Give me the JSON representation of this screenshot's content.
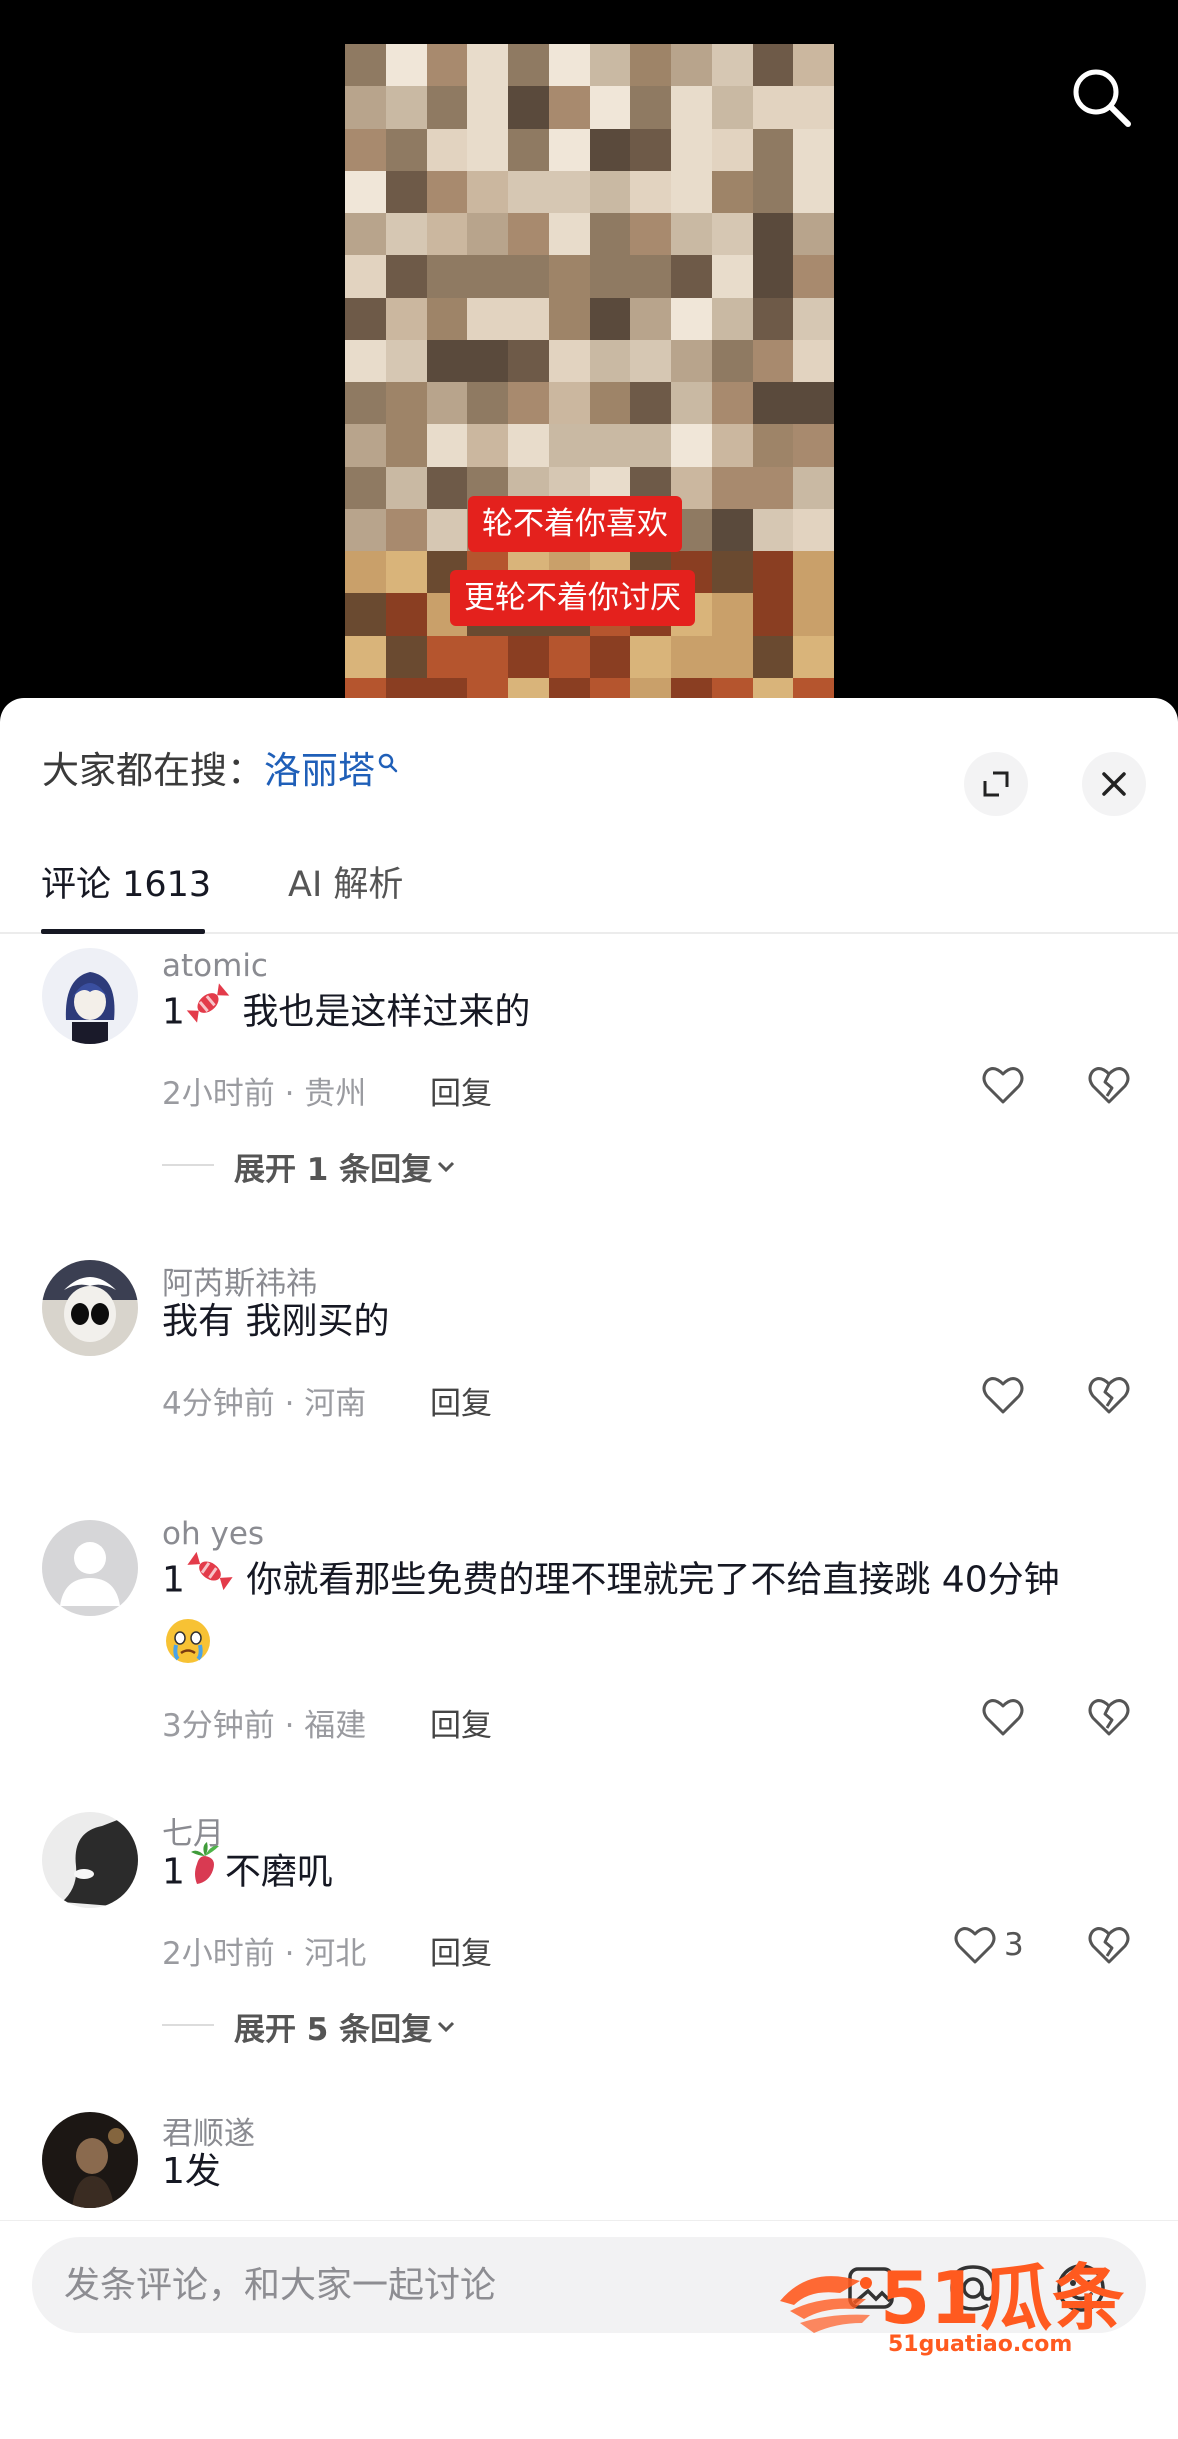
{
  "video": {
    "subtitle_line_1": "轮不着你喜欢",
    "subtitle_line_2": "更轮不着你讨厌"
  },
  "sheet": {
    "search_hint_prefix": "大家都在搜：",
    "search_hint_keyword": "洛丽塔",
    "tabs": [
      {
        "label": "评论 1613",
        "active": true
      },
      {
        "label": "AI 解析",
        "active": false
      }
    ]
  },
  "comments": [
    {
      "user": "atomic",
      "text": "我也是这样过来的",
      "prefix": "1",
      "emoji": "candy-emoji",
      "time": "2小时前",
      "location": "贵州",
      "reply_label": "回复",
      "likes": "",
      "expand_label": "展开 1 条回复"
    },
    {
      "user": "阿芮斯祎祎",
      "text": "我有 我刚买的",
      "time": "4分钟前",
      "location": "河南",
      "reply_label": "回复",
      "likes": ""
    },
    {
      "user": "oh yes",
      "prefix": "1",
      "emoji": "candy-emoji",
      "text": "你就看那些免费的理不理就完了不给直接跳 40分钟",
      "emoji_after": "crying-emoji",
      "time": "3分钟前",
      "location": "福建",
      "reply_label": "回复",
      "likes": ""
    },
    {
      "user": "七月",
      "prefix": "1",
      "emoji": "radish-emoji",
      "text": "不磨叽",
      "time": "2小时前",
      "location": "河北",
      "reply_label": "回复",
      "likes": "3",
      "expand_label": "展开 5 条回复"
    },
    {
      "user": "君顺遂",
      "text": "1发"
    }
  ],
  "meta_separator": " · ",
  "input": {
    "placeholder": "发条评论，和大家一起讨论"
  },
  "watermark": {
    "brand": "51瓜条",
    "url": "51guatiao.com"
  },
  "colors": {
    "accent_link": "#1f5fb8",
    "subtitle_bg": "#e4211d",
    "watermark": "#ff5a1f"
  }
}
